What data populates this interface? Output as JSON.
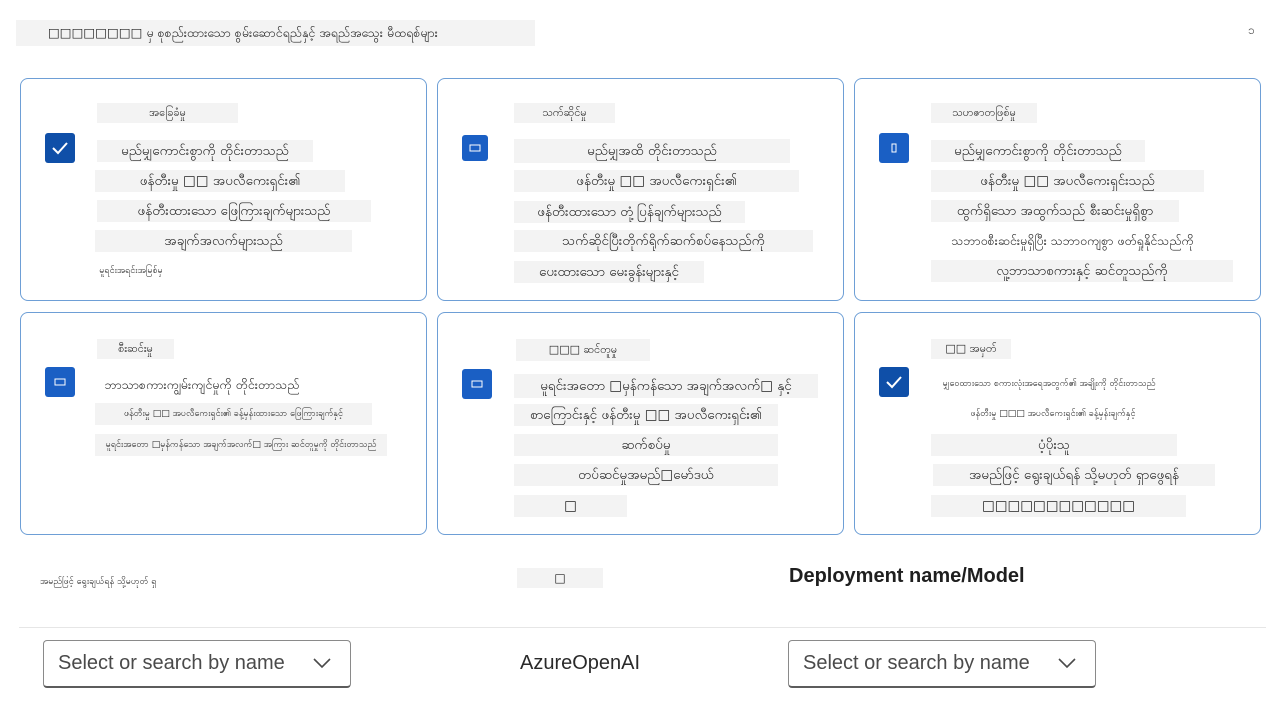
{
  "header": {
    "title": "□□□□□□□□ မှ စုစည်းထားသော စွမ်းဆောင်ရည်နှင့် အရည်အသွေး မီထရစ်များ",
    "corner": "ၥ"
  },
  "cards": [
    {
      "title": "အခြေခံမှု",
      "checkbox": "checked",
      "lines": [
        "မည်မျှကောင်းစွာကို တိုင်းတာသည်",
        "ဖန်တီးမှု □□ အပလီကေးရှင်း၏",
        "ဖန်တီးထားသော ဖြေကြားချက်များသည်",
        "အချက်အလက်များသည်",
        "မူရင်းအရင်းအမြစ်မှ"
      ]
    },
    {
      "title": "သက်ဆိုင်မှု",
      "checkbox": "partial",
      "lines": [
        "မည်မျှအထိ တိုင်းတာသည်",
        "ဖန်တီးမှု □□ အပလီကေးရှင်း၏",
        "ဖန်တီးထားသော တုံ့ပြန်ချက်များသည်",
        "သက်ဆိုင်ပြီးတိုက်ရိုက်ဆက်စပ်နေသည်ကို",
        "ပေးထားသော မေးခွန်းများနှင့်"
      ]
    },
    {
      "title": "သဟဇာတဖြစ်မှု",
      "checkbox": "partial",
      "lines": [
        "မည်မျှကောင်းစွာကို တိုင်းတာသည်",
        "ဖန်တီးမှု □□ အပလီကေးရှင်းသည်",
        "ထွက်ရှိသော အထွက်သည် စီးဆင်းမှုရှိစွာ",
        "သဘာဝစီးဆင်းမှုရှိပြီး သဘာဝကျစွာ ဖတ်ရှုနိုင်သည်ကို",
        "လူ့ဘာသာစကားနှင့် ဆင်တူသည်ကို"
      ]
    },
    {
      "title": "စီးဆင်းမှု",
      "checkbox": "partial",
      "lines": [
        "ဘာသာစကားကျွမ်းကျင်မှုကို တိုင်းတာသည်",
        "ဖန်တီးမှု □□ အပလီကေးရှင်း၏ ခန့်မှန်းထားသော ဖြေကြားချက်နှင့်",
        "မူရင်းအတော □မှန်ကန်သော အချက်အလက်□ အကြား ဆင်တူမှုကို တိုင်းတာသည်"
      ]
    },
    {
      "title": "□□□ ဆင်တူမှု",
      "checkbox": "partial",
      "lines": [
        "မူရင်းအတော □မှန်ကန်သော အချက်အလက်□ နှင့်",
        "စာကြောင်းနှင့် ဖန်တီးမှု □□ အပလီကေးရှင်း၏",
        "ဆက်စပ်မှု",
        "တပ်ဆင်မှုအမည်□မော်ဒယ်",
        "□"
      ]
    },
    {
      "title": "□□ အမှတ်",
      "checkbox": "checked",
      "lines": [
        "မျှဝေထားသော စကားလုံးအရေအတွက်၏ အချိုးကို တိုင်းတာသည်",
        "ဖန်တီးမှု □□□ အပလီကေးရှင်း၏ ခန့်မှန်းချက်နှင့်",
        "ပံ့ပိုးသူ",
        "အမည်ဖြင့် ရွေးချယ်ရန် သို့မဟုတ် ရှာဖွေရန်",
        "□□□□□□□□□□□□"
      ]
    }
  ],
  "footer": {
    "left_label": "အမည်ဖြင့် ရွေးချယ်ရန် သို့မဟုတ် ရှာဖွေရန်",
    "mid_label": "□",
    "right_label": "Deployment name/Model",
    "select_left_placeholder": "Select or search by name",
    "provider": "AzureOpenAI",
    "select_right_placeholder": "Select or search by name"
  },
  "colors": {
    "accent": "#0f4fa8",
    "card_border": "#6e9fd6",
    "text_bg": "#f3f3f3"
  }
}
